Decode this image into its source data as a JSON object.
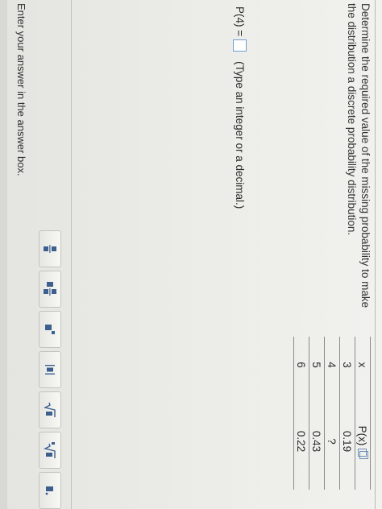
{
  "question": {
    "text": "Determine the required value of the missing probability to make the distribution a discrete probability distribution."
  },
  "table": {
    "header_x": "x",
    "header_p": "P(x)",
    "rows": [
      {
        "x": "3",
        "p": "0.19"
      },
      {
        "x": "4",
        "p": "?"
      },
      {
        "x": "5",
        "p": "0.43"
      },
      {
        "x": "6",
        "p": "0.22"
      }
    ]
  },
  "answer": {
    "label": "P(4) =",
    "value": "",
    "hint": "(Type an integer or a decimal.)"
  },
  "footer": {
    "instruction": "Enter your answer in the answer box."
  },
  "toolbar": {
    "buttons": [
      "fraction-icon",
      "mixed-number-icon",
      "exponent-icon",
      "absolute-value-icon",
      "square-root-icon",
      "nth-root-icon",
      "decimal-icon"
    ]
  },
  "colors": {
    "accent": "#3c5f8e",
    "answer_box_border": "#6f9fd4"
  }
}
